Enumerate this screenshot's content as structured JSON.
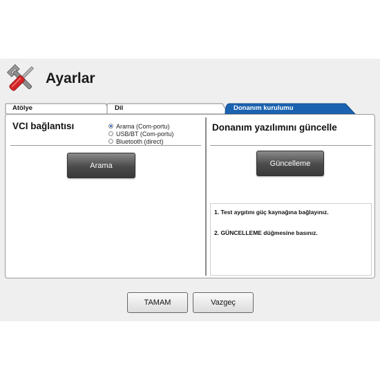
{
  "header": {
    "title": "Ayarlar",
    "icon": "tools-icon"
  },
  "tabs": [
    {
      "label": "Atölye",
      "active": false
    },
    {
      "label": "Dil",
      "active": false
    },
    {
      "label": "Donanım kurulumu",
      "active": true
    }
  ],
  "vci": {
    "title": "VCI bağlantısı",
    "options": [
      {
        "label": "Arama (Com-portu)",
        "checked": true
      },
      {
        "label": "USB/BT (Com-portu)",
        "checked": false
      },
      {
        "label": "Bluetooth (direct)",
        "checked": false
      }
    ],
    "search_button": "Arama"
  },
  "firmware": {
    "title": "Donanım yazılımını güncelle",
    "update_button": "Güncelleme",
    "instructions": [
      "1. Test aygıtını güç kaynağına bağlayınız.",
      "2. GÜNCELLEME düğmesine basınız."
    ]
  },
  "footer": {
    "ok_label": "TAMAM",
    "cancel_label": "Vazgeç"
  },
  "colors": {
    "active_tab": "#1b63b0",
    "button_dark": "#4a4a4a",
    "radio_dot": "#1f5fbf"
  }
}
